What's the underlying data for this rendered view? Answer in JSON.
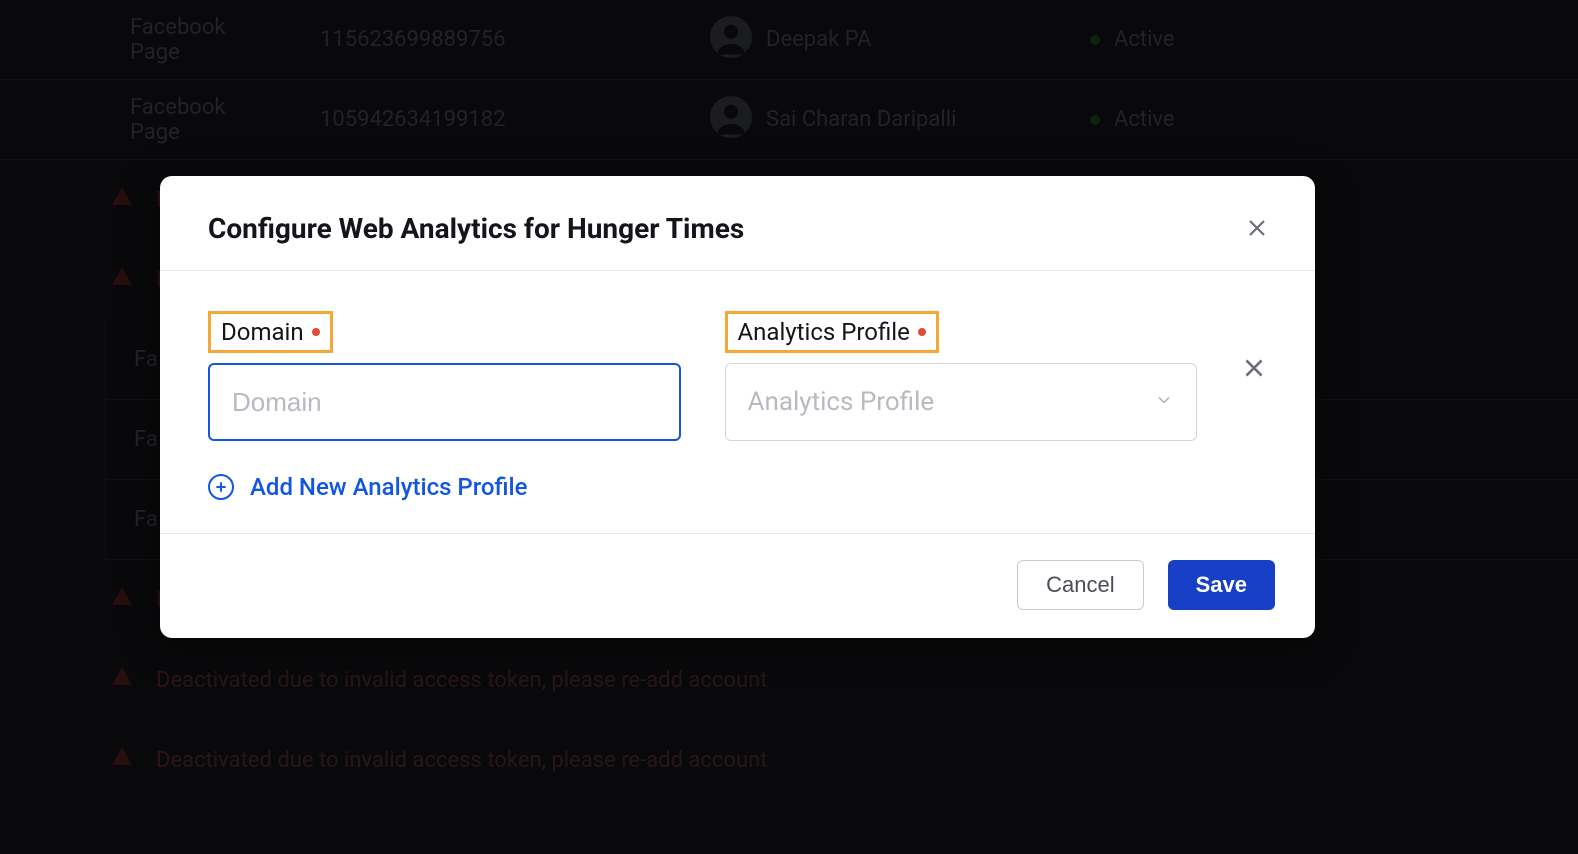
{
  "background": {
    "rows": [
      {
        "platform": "Facebook Page",
        "id": "115623699889756",
        "owner": "Deepak PA",
        "status": "Active"
      },
      {
        "platform": "Facebook Page",
        "id": "105942634199182",
        "owner": "Sai Charan Daripalli",
        "status": "Active"
      }
    ],
    "warning_d": "D",
    "pages": [
      "Fa",
      "Fa",
      "Fa"
    ],
    "warnings_full": [
      "Deactivated due to invalid access token, please re-add account",
      "Deactivated due to invalid access token, please re-add account"
    ]
  },
  "modal": {
    "title": "Configure Web Analytics for Hunger Times",
    "fields": {
      "domain_label": "Domain",
      "domain_placeholder": "Domain",
      "profile_label": "Analytics Profile",
      "profile_placeholder": "Analytics Profile"
    },
    "add_label": "Add New Analytics Profile",
    "cancel_label": "Cancel",
    "save_label": "Save"
  }
}
